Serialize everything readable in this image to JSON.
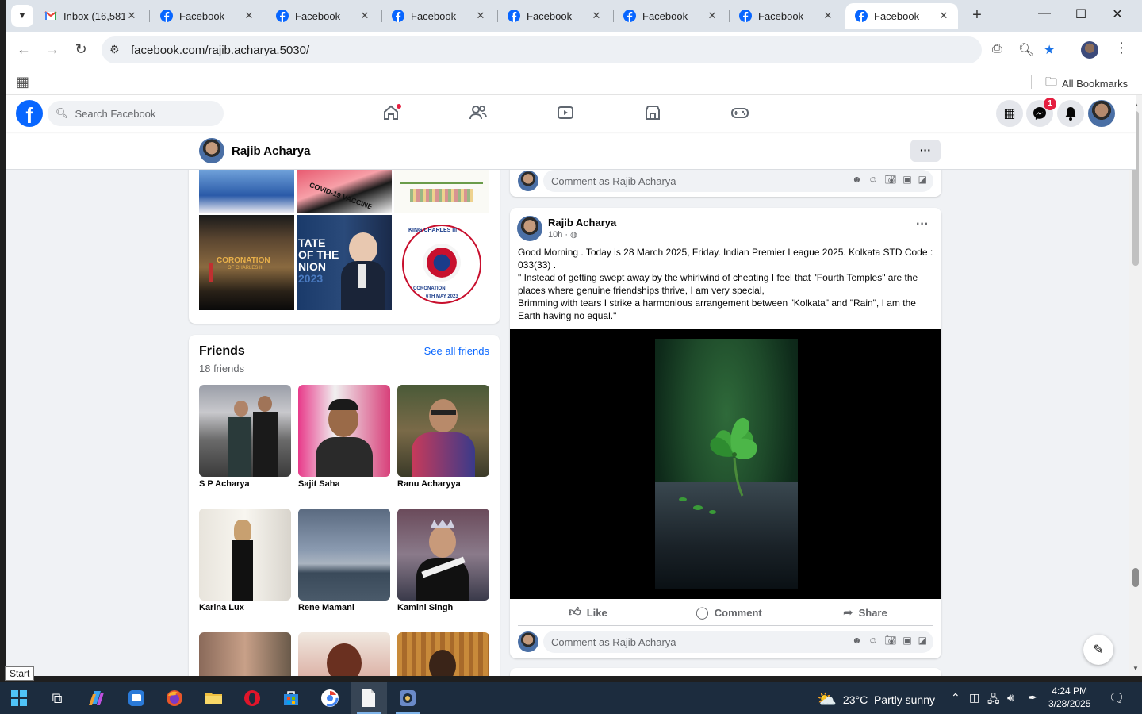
{
  "browser": {
    "tabs": [
      {
        "title": "Inbox (16,581)",
        "icon": "gmail-icon"
      },
      {
        "title": "Facebook",
        "icon": "facebook-icon"
      },
      {
        "title": "Facebook",
        "icon": "facebook-icon"
      },
      {
        "title": "Facebook",
        "icon": "facebook-icon"
      },
      {
        "title": "Facebook",
        "icon": "facebook-icon"
      },
      {
        "title": "Facebook",
        "icon": "facebook-icon"
      },
      {
        "title": "Facebook",
        "icon": "facebook-icon"
      },
      {
        "title": "Facebook",
        "icon": "facebook-icon"
      }
    ],
    "active_tab": 7,
    "url": "facebook.com/rajib.acharya.5030/",
    "bookmarks_label": "All Bookmarks"
  },
  "facebook": {
    "search_placeholder": "Search Facebook",
    "messenger_badge": "1",
    "profile_name": "Rajib Acharya",
    "more_label": "···",
    "photo_captions": [
      "CORONATION",
      "OF CHARLES III",
      "TATE",
      "OF THE",
      "NION",
      "2023",
      "KING CHARLES III",
      "CORONATION",
      "6TH MAY 2023",
      "COVID-19 VACCINE"
    ],
    "friends": {
      "title": "Friends",
      "count": "18 friends",
      "see_all": "See all friends",
      "list": [
        {
          "name": "S P Acharya"
        },
        {
          "name": "Sajit Saha"
        },
        {
          "name": "Ranu Acharyya"
        },
        {
          "name": "Karina Lux"
        },
        {
          "name": "Rene Mamani"
        },
        {
          "name": "Kamini Singh"
        }
      ]
    },
    "comment_placeholder": "Comment as Rajib Acharya",
    "post": {
      "author": "Rajib Acharya",
      "time": "10h",
      "lines": [
        "Good Morning . Today is 28 March 2025, Friday. Indian Premier League 2025. Kolkata STD Code : 033(33) .",
        "\" Instead of getting swept away by the whirlwind of cheating I feel that \"Fourth Temples\" are the places where genuine friendships thrive, I am very special,",
        "Brimming with tears I strike a harmonious arrangement between \"Kolkata\" and \"Rain\", I am the Earth having no equal.\""
      ],
      "actions": {
        "like": "Like",
        "comment": "Comment",
        "share": "Share"
      }
    }
  },
  "tooltip": {
    "start": "Start"
  },
  "taskbar": {
    "weather": "23°C  Partly sunny",
    "time": "4:24 PM",
    "date": "3/28/2025"
  }
}
